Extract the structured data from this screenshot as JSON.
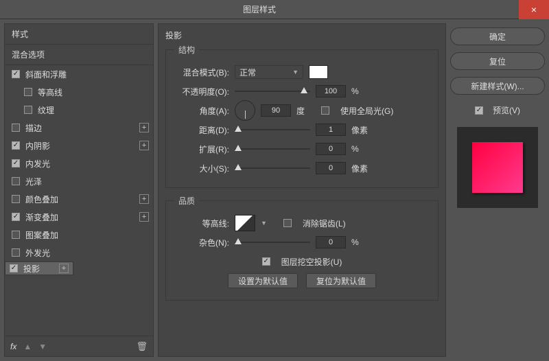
{
  "window": {
    "title": "图层样式"
  },
  "left": {
    "header": "样式",
    "subheader": "混合选项",
    "items": [
      {
        "label": "斜面和浮雕",
        "checked": true,
        "plus": false,
        "indent": false
      },
      {
        "label": "等高线",
        "checked": false,
        "plus": false,
        "indent": true
      },
      {
        "label": "纹理",
        "checked": false,
        "plus": false,
        "indent": true
      },
      {
        "label": "描边",
        "checked": false,
        "plus": true,
        "indent": false
      },
      {
        "label": "内阴影",
        "checked": true,
        "plus": true,
        "indent": false
      },
      {
        "label": "内发光",
        "checked": true,
        "plus": false,
        "indent": false
      },
      {
        "label": "光泽",
        "checked": false,
        "plus": false,
        "indent": false
      },
      {
        "label": "颜色叠加",
        "checked": false,
        "plus": true,
        "indent": false
      },
      {
        "label": "渐变叠加",
        "checked": true,
        "plus": true,
        "indent": false
      },
      {
        "label": "图案叠加",
        "checked": false,
        "plus": false,
        "indent": false
      },
      {
        "label": "外发光",
        "checked": false,
        "plus": false,
        "indent": false
      },
      {
        "label": "投影",
        "checked": true,
        "plus": true,
        "indent": false,
        "selected": true
      }
    ],
    "fx": "fx"
  },
  "mid": {
    "title": "投影",
    "structure": {
      "legend": "结构",
      "blend_label": "混合模式(B):",
      "blend_value": "正常",
      "opacity_label": "不透明度(O):",
      "opacity_value": "100",
      "opacity_unit": "%",
      "angle_label": "角度(A):",
      "angle_value": "90",
      "angle_unit": "度",
      "global_label": "使用全局光(G)",
      "distance_label": "距离(D):",
      "distance_value": "1",
      "distance_unit": "像素",
      "spread_label": "扩展(R):",
      "spread_value": "0",
      "spread_unit": "%",
      "size_label": "大小(S):",
      "size_value": "0",
      "size_unit": "像素"
    },
    "quality": {
      "legend": "品质",
      "contour_label": "等高线:",
      "antialias_label": "消除锯齿(L)",
      "noise_label": "杂色(N):",
      "noise_value": "0",
      "noise_unit": "%",
      "knockout_label": "图层挖空投影(U)",
      "set_default": "设置为默认值",
      "reset_default": "复位为默认值"
    }
  },
  "right": {
    "ok": "确定",
    "cancel": "复位",
    "new_style": "新建样式(W)...",
    "preview": "预览(V)"
  }
}
